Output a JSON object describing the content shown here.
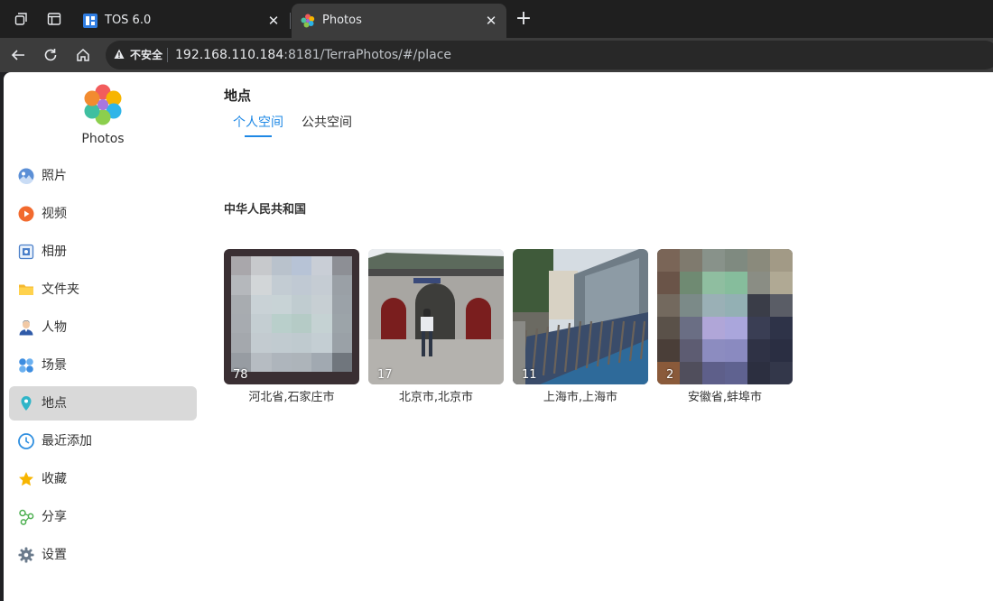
{
  "browser": {
    "tabs": [
      {
        "title": "TOS 6.0",
        "active": false
      },
      {
        "title": "Photos",
        "active": true
      }
    ],
    "security_label": "不安全",
    "url_host": "192.168.110.184",
    "url_rest": ":8181/TerraPhotos/#/place"
  },
  "app": {
    "name": "Photos"
  },
  "sidebar": {
    "items": [
      {
        "label": "照片",
        "icon": "photo-icon"
      },
      {
        "label": "视频",
        "icon": "video-icon"
      },
      {
        "label": "相册",
        "icon": "album-icon"
      },
      {
        "label": "文件夹",
        "icon": "folder-icon"
      },
      {
        "label": "人物",
        "icon": "person-icon"
      },
      {
        "label": "场景",
        "icon": "scene-icon"
      },
      {
        "label": "地点",
        "icon": "location-icon",
        "selected": true
      },
      {
        "label": "最近添加",
        "icon": "clock-icon"
      },
      {
        "label": "收藏",
        "icon": "star-icon"
      },
      {
        "label": "分享",
        "icon": "share-icon"
      },
      {
        "label": "设置",
        "icon": "gear-icon"
      }
    ]
  },
  "main": {
    "title": "地点",
    "tabs": [
      {
        "label": "个人空间",
        "active": true
      },
      {
        "label": "公共空间",
        "active": false
      }
    ],
    "section": "中华人民共和国",
    "places": [
      {
        "name": "河北省,石家庄市",
        "count": "78"
      },
      {
        "name": "北京市,北京市",
        "count": "17"
      },
      {
        "name": "上海市,上海市",
        "count": "11"
      },
      {
        "name": "安徽省,蚌埠市",
        "count": "2"
      }
    ]
  },
  "colors": {
    "accent": "#1e88e5",
    "selected_bg": "#d9d9d9"
  }
}
